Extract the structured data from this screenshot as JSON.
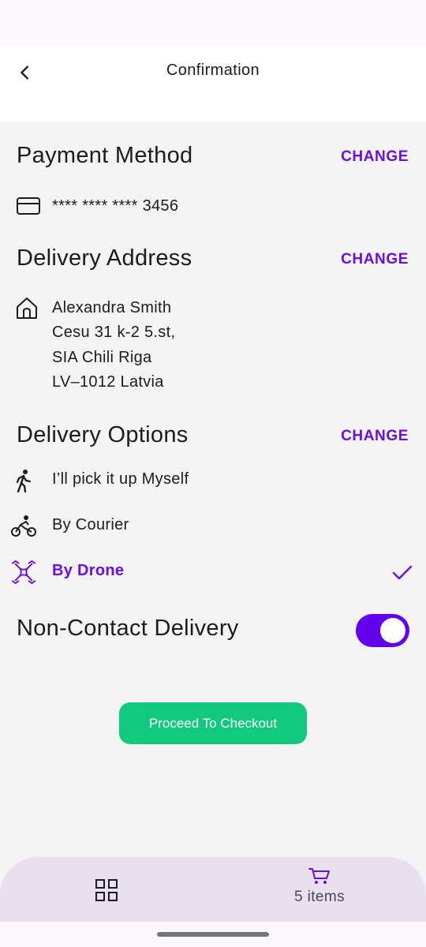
{
  "header": {
    "title": "Confirmation",
    "back_icon": "chevron-left-icon"
  },
  "payment": {
    "title": "Payment Method",
    "change_label": "CHANGE",
    "card_masked": "**** **** **** 3456",
    "icon": "credit-card-icon"
  },
  "address": {
    "title": "Delivery Address",
    "change_label": "CHANGE",
    "icon": "home-icon",
    "lines": [
      "Alexandra Smith",
      "Cesu 31 k-2 5.st,",
      "SIA Chili Riga",
      "LV–1012 Latvia"
    ]
  },
  "delivery": {
    "title": "Delivery Options",
    "change_label": "CHANGE",
    "options": [
      {
        "label": "I’ll pick it up Myself",
        "icon": "walking-person-icon",
        "selected": false
      },
      {
        "label": "By Courier",
        "icon": "bicycle-icon",
        "selected": false
      },
      {
        "label": "By Drone",
        "icon": "drone-icon",
        "selected": true
      }
    ]
  },
  "non_contact": {
    "label": "Non-Contact Delivery",
    "enabled": true
  },
  "checkout": {
    "label": "Proceed To Checkout"
  },
  "bottom_nav": {
    "grid_icon": "grid-icon",
    "cart_icon": "cart-icon",
    "cart_label": "5 items"
  },
  "colors": {
    "accent": "#6a0fe0",
    "toggle": "#6200ee",
    "checkout": "#11c97f",
    "background": "#f4f4f4",
    "nav_bg": "#e8e0ee"
  }
}
